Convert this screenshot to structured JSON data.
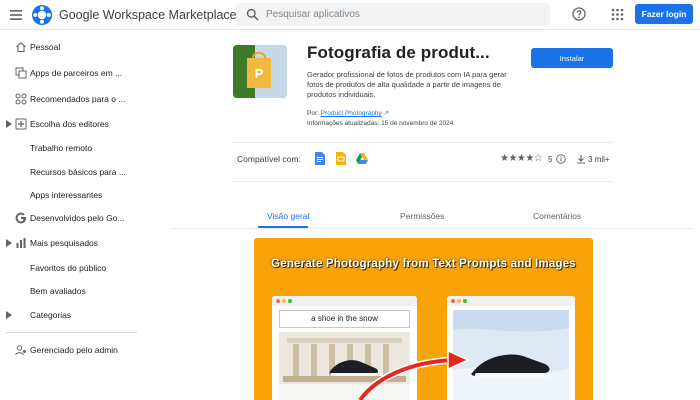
{
  "header": {
    "app_title": "Google Workspace Marketplace",
    "search_placeholder": "Pesquisar aplicativos",
    "login_label": "Fazer login"
  },
  "sidebar": {
    "items": [
      {
        "label": "Pessoal",
        "icon": "home-icon"
      },
      {
        "label": "Apps de parceiros em ...",
        "icon": "partner-apps-icon"
      },
      {
        "label": "Recomendados para o ...",
        "icon": "recommended-icon"
      },
      {
        "label": "Escolha dos editores",
        "icon": "editors-choice-icon"
      },
      {
        "label": "Trabalho remoto"
      },
      {
        "label": "Recursos básicos para ..."
      },
      {
        "label": "Apps interessantes"
      },
      {
        "label": "Desenvolvidos pelo Go...",
        "icon": "google-g-icon"
      },
      {
        "label": "Mais pesquisados",
        "icon": "chart-icon"
      },
      {
        "label": "Favoritos do público"
      },
      {
        "label": "Bem avaliados"
      },
      {
        "label": "Categorias"
      },
      {
        "label": "Gerenciado pelo admin",
        "icon": "admin-icon"
      }
    ]
  },
  "product": {
    "title": "Fotografia de produt...",
    "description": "Gerador profissional de fotos de produtos com IA para gerar fotos de produtos de alta qualidade a partir de imagens de produtos individuais.",
    "by_prefix": "Por:",
    "developer": "Product Photography",
    "updated": "Informações atualizadas: 15 de novembro de 2024",
    "install_label": "Instalar",
    "compat_label": "Compatível com:",
    "rating": 4,
    "rating_count": "5",
    "downloads": "3 mil+"
  },
  "tabs": [
    {
      "label": "Visão geral",
      "active": true
    },
    {
      "label": "Permissões",
      "active": false
    },
    {
      "label": "Comentários",
      "active": false
    }
  ],
  "banner": {
    "title": "Generate Photography from Text Prompts and Images",
    "prompt_text": "a shoe in the snow",
    "background_color": "#f9a30a"
  },
  "colors": {
    "accent": "#1a73e8",
    "banner": "#f9a30a"
  }
}
